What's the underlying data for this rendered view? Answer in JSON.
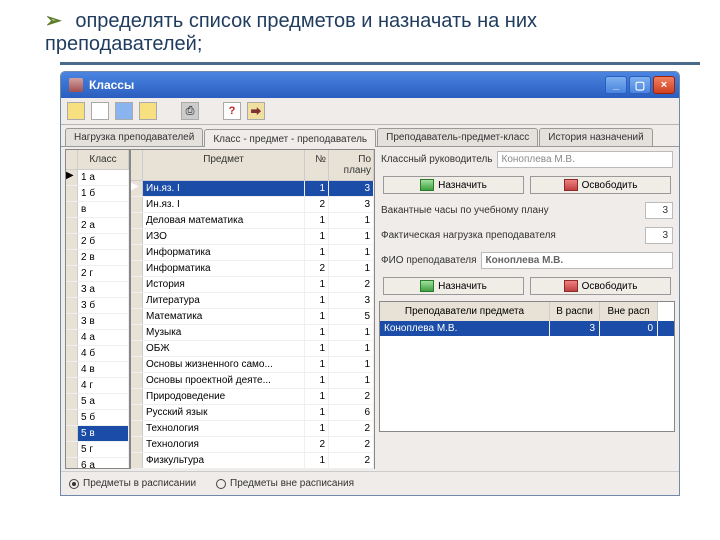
{
  "slide": {
    "bullet_text": "определять список предметов и назначать на них преподавателей;"
  },
  "window": {
    "title": "Классы",
    "toolbar_help": "?",
    "tabs": [
      "Нагрузка преподавателей",
      "Класс - предмет - преподаватель",
      "Преподаватель-предмет-класс",
      "История назначений"
    ],
    "active_tab": 1
  },
  "grids": {
    "class_header": "Класс",
    "subject_header": "Предмет",
    "n_header": "№",
    "plan_header": "По плану",
    "classes": [
      "1 а",
      "1 б",
      "в",
      "2 а",
      "2 б",
      "2 в",
      "2 г",
      "3 а",
      "3 б",
      "3 в",
      "4 а",
      "4 б",
      "4 в",
      "4 г",
      "5 а",
      "5 б",
      "5 в",
      "5 г",
      "6 а"
    ],
    "class_selected": 16,
    "subjects": [
      {
        "name": "Ин.яз. I",
        "n": 1,
        "plan": 3,
        "sel": true
      },
      {
        "name": "Ин.яз. I",
        "n": 2,
        "plan": 3
      },
      {
        "name": "Деловая математика",
        "n": 1,
        "plan": 1
      },
      {
        "name": "ИЗО",
        "n": 1,
        "plan": 1
      },
      {
        "name": "Информатика",
        "n": 1,
        "plan": 1
      },
      {
        "name": "Информатика",
        "n": 2,
        "plan": 1
      },
      {
        "name": "История",
        "n": 1,
        "plan": 2
      },
      {
        "name": "Литература",
        "n": 1,
        "plan": 3
      },
      {
        "name": "Математика",
        "n": 1,
        "plan": 5
      },
      {
        "name": "Музыка",
        "n": 1,
        "plan": 1
      },
      {
        "name": "ОБЖ",
        "n": 1,
        "plan": 1
      },
      {
        "name": "Основы жизненного само...",
        "n": 1,
        "plan": 1
      },
      {
        "name": "Основы проектной деяте...",
        "n": 1,
        "plan": 1
      },
      {
        "name": "Природоведение",
        "n": 1,
        "plan": 2
      },
      {
        "name": "Русский язык",
        "n": 1,
        "plan": 6
      },
      {
        "name": "Технология",
        "n": 1,
        "plan": 2
      },
      {
        "name": "Технология",
        "n": 2,
        "plan": 2
      },
      {
        "name": "Физкультура",
        "n": 1,
        "plan": 2
      }
    ]
  },
  "right": {
    "class_teacher_label": "Классный руководитель",
    "class_teacher_value": "Коноплева М.В.",
    "assign_btn": "Назначить",
    "release_btn": "Освободить",
    "vacant_label": "Вакантные часы по учебному плану",
    "vacant_value": "3",
    "actual_label": "Фактическая нагрузка преподавателя",
    "actual_value": "3",
    "fio_label": "ФИО преподавателя",
    "fio_value": "Коноплева М.В.",
    "teachers_header": "Преподаватели предмета",
    "in_sched": "В распи",
    "out_sched": "Вне расп",
    "teacher_rows": [
      {
        "name": "Коноплева М.В.",
        "in": 3,
        "out": 0,
        "sel": true
      }
    ]
  },
  "radios": {
    "opt1": "Предметы в расписании",
    "opt2": "Предметы вне расписания",
    "selected": 0
  }
}
